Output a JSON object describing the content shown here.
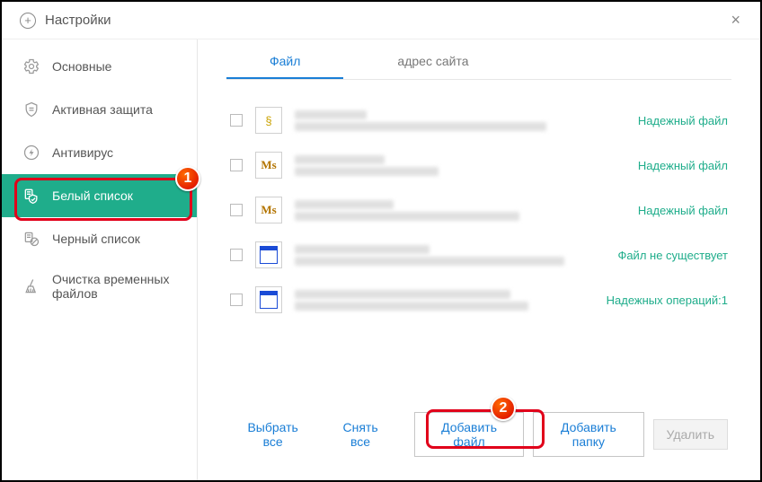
{
  "window": {
    "title": "Настройки"
  },
  "sidebar": {
    "items": [
      {
        "label": "Основные"
      },
      {
        "label": "Активная защита"
      },
      {
        "label": "Антивирус"
      },
      {
        "label": "Белый список"
      },
      {
        "label": "Черный список"
      },
      {
        "label": "Очистка временных файлов"
      }
    ]
  },
  "tabs": {
    "file": "Файл",
    "site": "адрес сайта"
  },
  "list": {
    "rows": [
      {
        "status": "Надежный файл",
        "status_kind": "trusted",
        "icon": "script"
      },
      {
        "status": "Надежный файл",
        "status_kind": "trusted",
        "icon": "ms"
      },
      {
        "status": "Надежный файл",
        "status_kind": "trusted",
        "icon": "ms"
      },
      {
        "status": "Файл не существует",
        "status_kind": "missing",
        "icon": "win"
      },
      {
        "status": "Надежных операций:1",
        "status_kind": "ops",
        "icon": "win"
      }
    ]
  },
  "footer": {
    "select_all": "Выбрать все",
    "deselect_all": "Снять все",
    "add_file": "Добавить файл",
    "add_folder": "Добавить папку",
    "delete": "Удалить"
  },
  "annotations": {
    "one": "1",
    "two": "2"
  }
}
